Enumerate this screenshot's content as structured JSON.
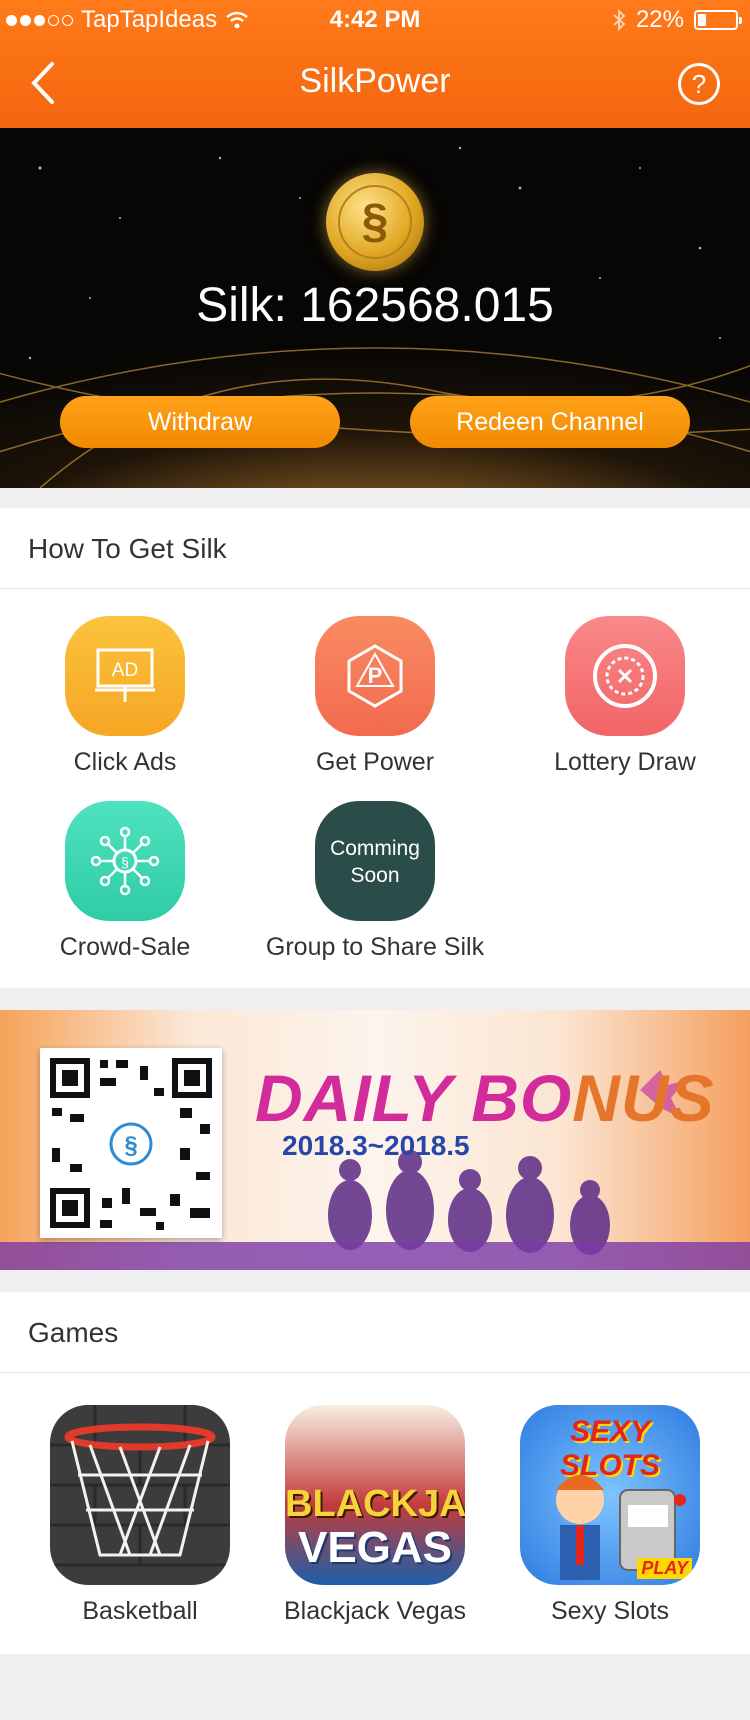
{
  "status_bar": {
    "carrier": "TapTapIdeas",
    "time": "4:42 PM",
    "battery": "22%",
    "battery_level": 0.22
  },
  "nav": {
    "title": "SilkPower",
    "help_label": "?"
  },
  "hero": {
    "balance_text": "Silk: 162568.015",
    "withdraw_label": "Withdraw",
    "redeem_label": "Redeen Channel"
  },
  "how_to": {
    "header": "How To Get Silk",
    "items": [
      {
        "label": "Click Ads",
        "icon": "ad-board-icon",
        "color": "#f9b530"
      },
      {
        "label": "Get Power",
        "icon": "power-dice-icon",
        "color": "#f47a5a"
      },
      {
        "label": "Lottery Draw",
        "icon": "roulette-icon",
        "color": "#f57375"
      },
      {
        "label": "Crowd-Sale",
        "icon": "network-coin-icon",
        "color": "#3fd6b0"
      },
      {
        "label": "Group to Share Silk",
        "icon": "coming-soon-icon",
        "color": "#2b4d49",
        "overlay": "Comming Soon"
      }
    ]
  },
  "banner": {
    "title_part1": "DAILY BO",
    "title_part2": "NUS",
    "date_range": "2018.3~2018.5"
  },
  "games": {
    "header": "Games",
    "items": [
      {
        "label": "Basketball",
        "icon": "basketball-hoop-icon"
      },
      {
        "label": "Blackjack Vegas",
        "icon": "blackjack-vegas-icon",
        "art_text_1": "BLACKJAC",
        "art_text_2": "VEGAS"
      },
      {
        "label": "Sexy Slots",
        "icon": "sexy-slots-icon",
        "art_text_1": "SEXY SLOTS",
        "art_text_2": "PLAY"
      }
    ]
  }
}
